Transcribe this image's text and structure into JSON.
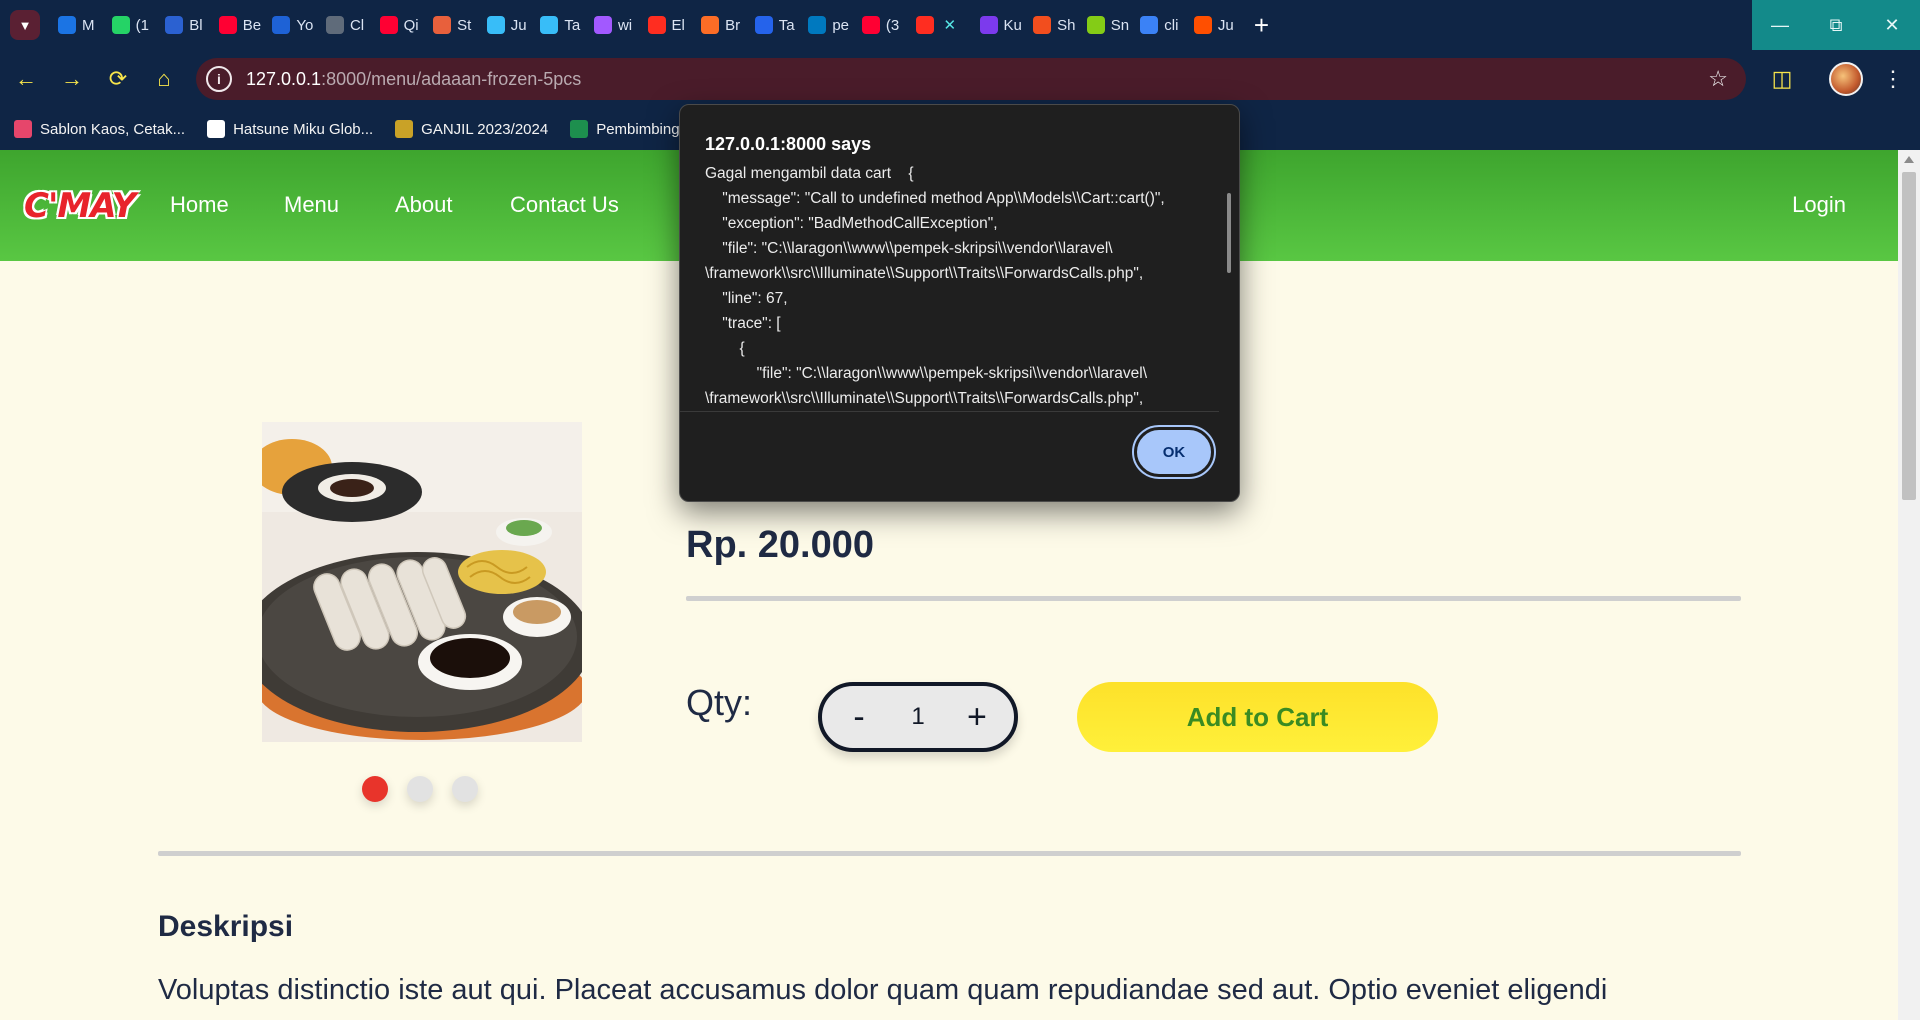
{
  "browser": {
    "tabs": [
      {
        "label": "M",
        "icon": "outlook-icon",
        "color": "#1b74e4"
      },
      {
        "label": "(1",
        "icon": "whatsapp-icon",
        "color": "#25d366"
      },
      {
        "label": "Bl",
        "icon": "blue-ring-icon",
        "color": "#2b61d1"
      },
      {
        "label": "Be",
        "icon": "youtube-icon",
        "color": "#ff0033"
      },
      {
        "label": "Yo",
        "icon": "globe-blue-icon",
        "color": "#1e62d6"
      },
      {
        "label": "Cl",
        "icon": "openai-icon",
        "color": "#5f6b7a"
      },
      {
        "label": "Qi",
        "icon": "youtube-icon",
        "color": "#ff0033"
      },
      {
        "label": "St",
        "icon": "star-burst-icon",
        "color": "#e8603c"
      },
      {
        "label": "Ju",
        "icon": "tailwind-icon",
        "color": "#38bdf8"
      },
      {
        "label": "Ta",
        "icon": "tailwind-icon",
        "color": "#38bdf8"
      },
      {
        "label": "wi",
        "icon": "figma-icon",
        "color": "#a259ff"
      },
      {
        "label": "El",
        "icon": "laravel-icon",
        "color": "#ff2d20"
      },
      {
        "label": "Br",
        "icon": "gitlab-icon",
        "color": "#fc6d26"
      },
      {
        "label": "Ta",
        "icon": "circle-blue-icon",
        "color": "#2563eb"
      },
      {
        "label": "pe",
        "icon": "trello-icon",
        "color": "#0079bf"
      },
      {
        "label": "(3",
        "icon": "youtube-icon",
        "color": "#ff0033"
      },
      {
        "label": "",
        "icon": "laravel-icon",
        "color": "#ff2d20",
        "active": true
      },
      {
        "label": "Ku",
        "icon": "list-purple-icon",
        "color": "#7c3aed"
      },
      {
        "label": "Sh",
        "icon": "figma-icon",
        "color": "#f24e1e"
      },
      {
        "label": "Sn",
        "icon": "snake-icon",
        "color": "#84cc16"
      },
      {
        "label": "cli",
        "icon": "moon-icon",
        "color": "#3b82f6"
      },
      {
        "label": "Ju",
        "icon": "k-icon",
        "color": "#ff4f00"
      }
    ],
    "url_host": "127.0.0.1",
    "url_rest": ":8000/menu/adaaan-frozen-5pcs",
    "bookmarks": [
      {
        "label": "Sablon Kaos, Cetak...",
        "color": "#e6466b"
      },
      {
        "label": "Hatsune Miku Glob...",
        "color": "#ffffff"
      },
      {
        "label": "GANJIL 2023/2024",
        "color": "#c9a227"
      },
      {
        "label": "Pembimbing",
        "color": "#1d8f4e"
      }
    ]
  },
  "site": {
    "logo": "C'MAY",
    "nav": [
      "Home",
      "Menu",
      "About",
      "Contact Us"
    ],
    "login": "Login"
  },
  "product": {
    "price": "Rp. 20.000",
    "qty_label": "Qty:",
    "qty_value": "1",
    "minus": "-",
    "plus": "+",
    "add_to_cart": "Add to Cart",
    "carousel_colors": [
      "#e8342b",
      "#e2e2e2",
      "#e2e2e2"
    ],
    "desc_title": "Deskripsi",
    "desc_text": "Voluptas distinctio iste aut qui. Placeat accusamus dolor quam quam repudiandae sed aut. Optio eveniet eligendi"
  },
  "dialog": {
    "title": "127.0.0.1:8000 says",
    "lines": [
      "Gagal mengambil data cart    {",
      "    \"message\": \"Call to undefined method App\\\\Models\\\\Cart::cart()\",",
      "    \"exception\": \"BadMethodCallException\",",
      "    \"file\": \"C:\\\\laragon\\\\www\\\\pempek-skripsi\\\\vendor\\\\laravel\\",
      "\\framework\\\\src\\\\Illuminate\\\\Support\\\\Traits\\\\ForwardsCalls.php\",",
      "    \"line\": 67,",
      "    \"trace\": [",
      "        {",
      "            \"file\": \"C:\\\\laragon\\\\www\\\\pempek-skripsi\\\\vendor\\\\laravel\\",
      "\\framework\\\\src\\\\Illuminate\\\\Support\\\\Traits\\\\ForwardsCalls.php\","
    ],
    "ok": "OK"
  }
}
